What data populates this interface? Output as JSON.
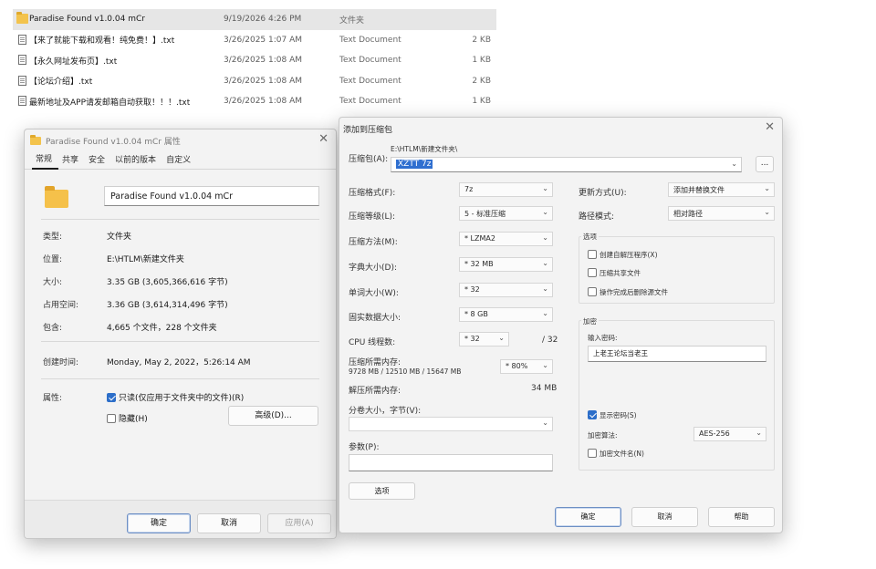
{
  "files": [
    {
      "name": "Paradise Found v1.0.04 mCr",
      "date": "9/19/2026 4:26 PM",
      "type": "文件夹",
      "size": "",
      "icon": "folder-icon",
      "selected": true
    },
    {
      "name": "【来了就能下载和观看！纯免费！】.txt",
      "date": "3/26/2025 1:07 AM",
      "type": "Text Document",
      "size": "2 KB",
      "icon": "text-file-icon"
    },
    {
      "name": "【永久网址发布页】.txt",
      "date": "3/26/2025 1:08 AM",
      "type": "Text Document",
      "size": "1 KB",
      "icon": "text-file-icon"
    },
    {
      "name": "【论坛介绍】.txt",
      "date": "3/26/2025 1:08 AM",
      "type": "Text Document",
      "size": "2 KB",
      "icon": "text-file-icon"
    },
    {
      "name": "最新地址及APP请发邮箱自动获取！！！.txt",
      "date": "3/26/2025 1:08 AM",
      "type": "Text Document",
      "size": "1 KB",
      "icon": "text-file-icon"
    }
  ],
  "properties": {
    "title": "Paradise Found v1.0.04 mCr 属性",
    "tabs": [
      "常规",
      "共享",
      "安全",
      "以前的版本",
      "自定义"
    ],
    "folder_name": "Paradise Found v1.0.04 mCr",
    "type_label": "类型:",
    "type_value": "文件夹",
    "location_label": "位置:",
    "location_value": "E:\\HTLM\\新建文件夹",
    "size_label": "大小:",
    "size_value": "3.35 GB (3,605,366,616 字节)",
    "disk_size_label": "占用空间:",
    "disk_size_value": "3.36 GB (3,614,314,496 字节)",
    "contains_label": "包含:",
    "contains_value": "4,665 个文件，228 个文件夹",
    "created_label": "创建时间:",
    "created_value": "Monday, May 2, 2022，5:26:14 AM",
    "attributes_label": "属性:",
    "readonly_label": "只读(仅应用于文件夹中的文件)(R)",
    "hidden_label": "隐藏(H)",
    "advanced_button": "高级(D)...",
    "ok_button": "确定",
    "cancel_button": "取消",
    "apply_button": "应用(A)"
  },
  "archive": {
    "title": "添加到压缩包",
    "archive_label": "压缩包(A):",
    "path_text": "E:\\HTLM\\新建文件夹\\",
    "archive_name": "XZTT 7z",
    "browse_label": "...",
    "format_label": "压缩格式(F):",
    "format_value": "7z",
    "level_label": "压缩等级(L):",
    "level_value": "5 - 标准压缩",
    "method_label": "压缩方法(M):",
    "method_value": "* LZMA2",
    "dict_label": "字典大小(D):",
    "dict_value": "* 32 MB",
    "word_label": "单词大小(W):",
    "word_value": "* 32",
    "solid_label": "固实数据大小:",
    "solid_value": "* 8 GB",
    "threads_label": "CPU 线程数:",
    "threads_value": "* 32",
    "threads_total": "/ 32",
    "mem_label": "压缩所需内存:",
    "mem_value": "9728 MB / 12510 MB / 15647 MB",
    "mem_percent": "* 80%",
    "decomp_label": "解压所需内存:",
    "decomp_value": "34 MB",
    "split_label": "分卷大小，字节(V):",
    "split_value": "",
    "params_label": "参数(P):",
    "params_value": "",
    "options_button": "选项",
    "update_label": "更新方式(U):",
    "update_value": "添加并替换文件",
    "path_mode_label": "路径模式:",
    "path_mode_value": "相对路径",
    "options_group": "选项",
    "opt_sfx": "创建自解压程序(X)",
    "opt_shared": "压缩共享文件",
    "opt_delete": "操作完成后删除源文件",
    "encrypt_group": "加密",
    "password_label": "输入密码:",
    "password_value": "上老王论坛当老王",
    "show_password_label": "显示密码(S)",
    "enc_method_label": "加密算法:",
    "enc_method_value": "AES-256",
    "enc_names_label": "加密文件名(N)",
    "ok_button": "确定",
    "cancel_button": "取消",
    "help_button": "帮助"
  }
}
